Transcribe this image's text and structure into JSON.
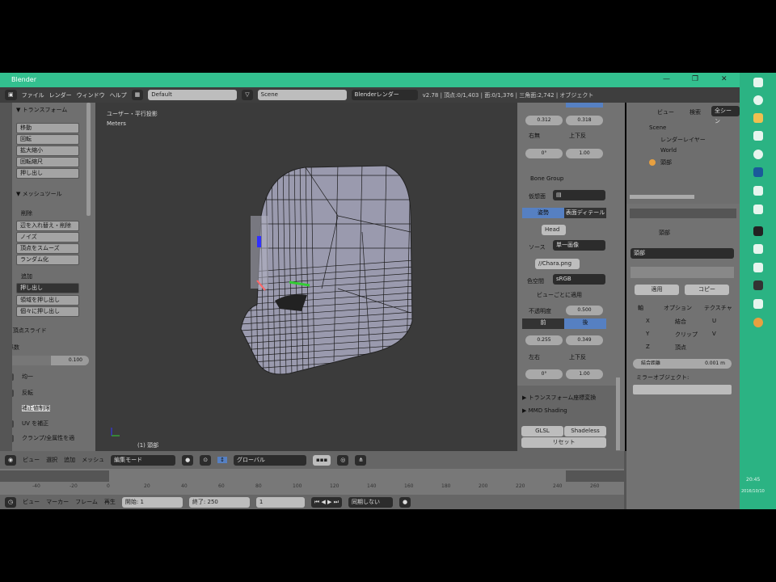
{
  "window": {
    "title": "Blender",
    "minimize": "—",
    "maximize": "❐",
    "close": "✕"
  },
  "menubar": {
    "items": [
      "ファイル",
      "レンダー",
      "ウィンドウ",
      "ヘルプ"
    ],
    "layout": "Default",
    "scene": "Scene",
    "engine": "Blenderレンダー",
    "stats": "v2.78 | 頂点:0/1,403 | 面:0/1,376 | 三角面:2,742 | オブジェクト"
  },
  "toolshelf": {
    "section1": "▼ トランスフォーム",
    "buttons1": [
      "移動",
      "回転",
      "拡大縮小",
      "回転縮尺",
      "押し出し"
    ],
    "section2": "▼ メッシュツール",
    "sub2": "削除",
    "buttons2": [
      "辺を入れ替え・削除",
      "ノイズ",
      "頂点をスムーズ",
      "ランダム化"
    ],
    "sub3": "追加",
    "dropdown3": "押し出し",
    "buttons3": [
      "領域を押し出し",
      "個々に押し出し"
    ],
    "section4": "▼ 頂点スライド",
    "slider_label": "係数",
    "slider_value": "0.100",
    "slider_fraction": 0.55,
    "checks": [
      {
        "label": "均一",
        "checked": false
      },
      {
        "label": "反転",
        "checked": false
      },
      {
        "label": "補正値制限",
        "checked": true
      },
      {
        "label": "UV を補正",
        "checked": false
      },
      {
        "label": "クランプ/全属性を適用",
        "checked": false
      }
    ]
  },
  "viewport": {
    "view_label": "ユーザー・平行投影",
    "unit": "Meters",
    "object_label": "(1) 頭部"
  },
  "npanel": {
    "values_a": [
      "0.312",
      "0.318"
    ],
    "checks_a": [
      "右無",
      "上下反"
    ],
    "values_b": [
      "0°",
      "1.00"
    ],
    "section": "Bone Group",
    "lock_label": "仮想面",
    "tabs": [
      "姿勢",
      "表面ディテール"
    ],
    "image": "Head",
    "source_label": "ソース",
    "source": "単一画像",
    "file": "//Chara.png",
    "color_label": "色空間",
    "color": "sRGB",
    "checkbox": "ビューごとに適用",
    "opacity_label": "不透明度",
    "opacity": "0.500",
    "toggle": [
      "前",
      "後"
    ],
    "values_c": [
      "0.255",
      "0.349"
    ],
    "checks_c": [
      "左右",
      "上下反"
    ],
    "values_d": [
      "0°",
      "1.00"
    ],
    "section2": "▶ トランスフォーム座標変換",
    "section3": "▶ MMD Shading",
    "buttons": [
      "GLSL",
      "Shadeless"
    ],
    "reset": "リセット"
  },
  "outliner": {
    "view": "ビュー",
    "search": "検索",
    "all": "全シーン",
    "items": [
      "Scene",
      "レンダーレイヤー",
      "World",
      "頭部"
    ]
  },
  "properties": {
    "object": "頭部",
    "slot": "頭部",
    "tabs": [
      "適用",
      "コピー"
    ],
    "axis_label": "軸",
    "mirror_label": "オプション",
    "target_label": "テクスチャ",
    "axes": [
      "X",
      "Y",
      "Z"
    ],
    "opts": [
      "結合",
      "クリップ",
      "頂点"
    ],
    "uvs": [
      "U",
      "V"
    ],
    "merge_label": "結合距離",
    "merge_value": "0.001 m",
    "object_mirror": "ミラーオブジェクト:"
  },
  "viewport_header": {
    "menus": [
      "ビュー",
      "選択",
      "追加",
      "メッシュ"
    ],
    "mode": "編集モード",
    "pivot": "グローバル"
  },
  "timeline": {
    "ticks": [
      "-40",
      "-20",
      "0",
      "20",
      "40",
      "60",
      "80",
      "100",
      "120",
      "140",
      "160",
      "180",
      "200",
      "220",
      "240",
      "260"
    ]
  },
  "timeline_header": {
    "menus": [
      "ビュー",
      "マーカー",
      "フレーム",
      "再生"
    ],
    "start": "開始: 1",
    "end": "終了: 250",
    "frame": "1",
    "sync": "同期しない"
  },
  "taskbar": {
    "time": "20:45",
    "date": "2016/10/10"
  }
}
